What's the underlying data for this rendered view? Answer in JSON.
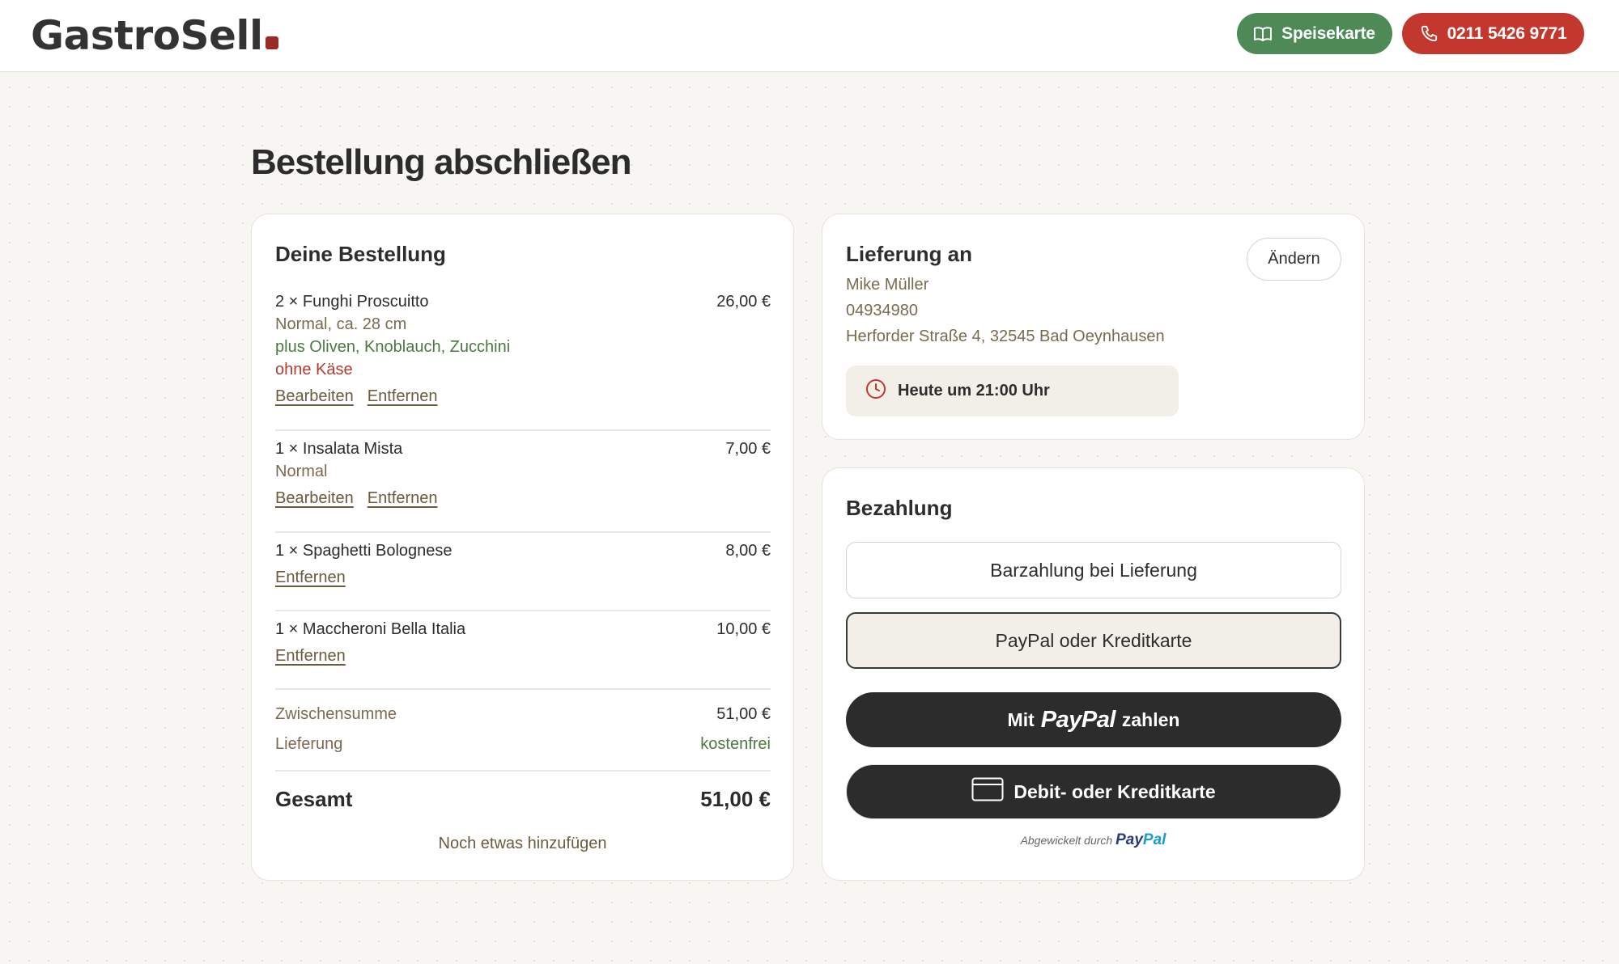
{
  "header": {
    "logo": "GastroSell",
    "menu_button": "Speisekarte",
    "phone_button": "0211 5426 9771",
    "colors": {
      "green": "#4d8a55",
      "red": "#c2382e",
      "logo_dot": "#9c2b22"
    }
  },
  "page_title": "Bestellung abschließen",
  "order": {
    "title": "Deine Bestellung",
    "items": [
      {
        "name": "2 × Funghi Proscuitto",
        "price": "26,00 €",
        "variant": "Normal, ca. 28 cm",
        "extras": "plus Oliven, Knoblauch, Zucchini",
        "without": "ohne Käse",
        "edit": "Bearbeiten",
        "remove": "Entfernen"
      },
      {
        "name": "1 × Insalata Mista",
        "price": "7,00 €",
        "variant": "Normal",
        "edit": "Bearbeiten",
        "remove": "Entfernen"
      },
      {
        "name": "1 × Spaghetti Bolognese",
        "price": "8,00 €",
        "remove": "Entfernen"
      },
      {
        "name": "1 × Maccheroni Bella Italia",
        "price": "10,00 €",
        "remove": "Entfernen"
      }
    ],
    "subtotal_label": "Zwischensumme",
    "subtotal": "51,00 €",
    "delivery_label": "Lieferung",
    "delivery_value": "kostenfrei",
    "total_label": "Gesamt",
    "total": "51,00 €",
    "add_more": "Noch etwas hinzufügen"
  },
  "delivery": {
    "title": "Lieferung an",
    "change": "Ändern",
    "name": "Mike Müller",
    "phone": "04934980",
    "address": "Herforder Straße 4, 32545 Bad Oeynhausen",
    "time": "Heute um 21:00 Uhr"
  },
  "payment": {
    "title": "Bezahlung",
    "option_cash": "Barzahlung bei Lieferung",
    "option_paypal": "PayPal oder Kreditkarte",
    "paypal_prefix": "Mit",
    "paypal_logo": "PayPal",
    "paypal_suffix": "zahlen",
    "card_button": "Debit- oder Kreditkarte",
    "powered_by": "Abgewickelt durch",
    "powered_logo_a": "Pay",
    "powered_logo_b": "Pal"
  }
}
